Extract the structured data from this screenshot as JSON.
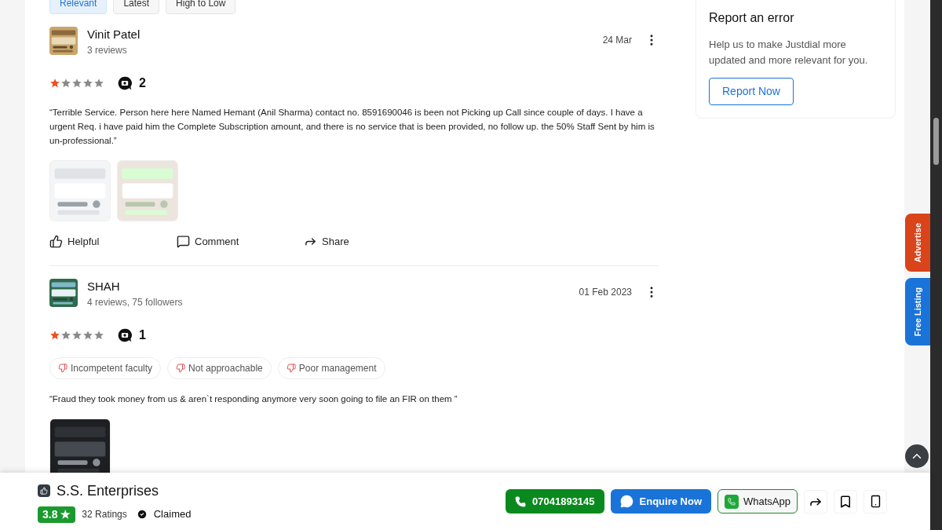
{
  "sort_tabs": [
    {
      "label": "Relevant",
      "selected": true
    },
    {
      "label": "Latest",
      "selected": false
    },
    {
      "label": "High to Low",
      "selected": false
    }
  ],
  "reviews": [
    {
      "avatar": {
        "kind": "picture"
      },
      "name": "Vinit Patel",
      "meta": "3 reviews",
      "date": "24 Mar",
      "stars": 1,
      "photo_count": "2",
      "text": "“Terrible Service. Person here here Named Hemant (Anil Sharma) contact no. 8591690046 is been not Picking up Call since couple of days. I have a urgent Req. i have paid him the Complete Subscription amount, and there is no service that is been provided, no follow up. the 50% Staff Sent by him is un-professional.”",
      "photos": [
        {
          "kind": "picture"
        },
        {
          "kind": "picture"
        }
      ],
      "actions": [
        "Helpful",
        "Comment",
        "Share"
      ]
    },
    {
      "avatar": {
        "kind": "picture"
      },
      "name": "SHAH",
      "meta": "4 reviews, 75 followers",
      "date": "01 Feb 2023",
      "stars": 1,
      "photo_count": "1",
      "tags": [
        "Incompetent faculty",
        "Not approachable",
        "Poor management"
      ],
      "text": "“Fraud they took money from us & aren`t responding anymore very soon going to file an FIR on them ”",
      "photos": [
        {
          "kind": "picture"
        }
      ]
    }
  ],
  "report_card": {
    "title": "Report an error",
    "text": "Help us to make Justdial more updated and more relevant for you.",
    "button": "Report Now"
  },
  "side_tabs": [
    {
      "label": "Advertise",
      "color": "#d9441a"
    },
    {
      "label": "Free Listing",
      "color": "#1a73d9"
    }
  ],
  "bottom_bar": {
    "name": "S.S. Enterprises",
    "rating": "3.8",
    "rating_star": "★",
    "ratings_count": "32 Ratings",
    "claimed": "Claimed",
    "phone": "07041893145",
    "enquire": "Enquire Now",
    "whatsapp": "WhatsApp"
  }
}
